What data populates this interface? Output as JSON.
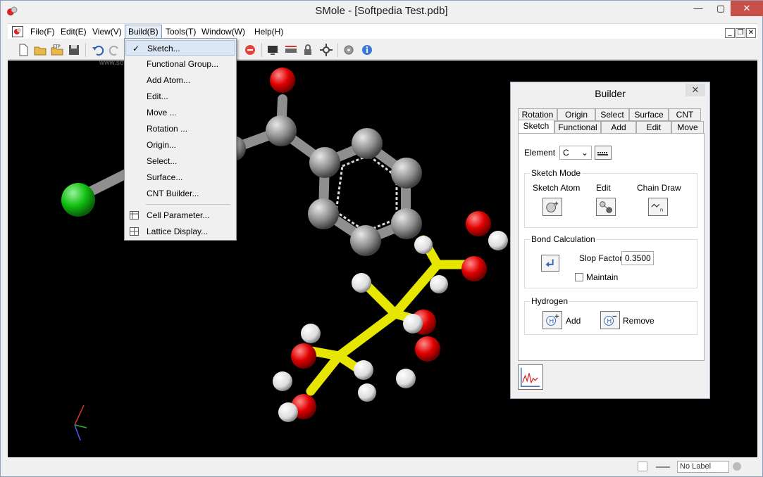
{
  "window": {
    "title": "SMole - [Softpedia Test.pdb]"
  },
  "menubar": {
    "items": [
      {
        "label": "File(F)"
      },
      {
        "label": "Edit(E)"
      },
      {
        "label": "View(V)"
      },
      {
        "label": "Build(B)"
      },
      {
        "label": "Tools(T)"
      },
      {
        "label": "Window(W)"
      },
      {
        "label": "Help(H)"
      }
    ]
  },
  "build_menu": {
    "items": [
      {
        "label": "Sketch...",
        "checked": true
      },
      {
        "label": "Functional Group..."
      },
      {
        "label": "Add Atom..."
      },
      {
        "label": "Edit..."
      },
      {
        "label": "Move ..."
      },
      {
        "label": "Rotation ..."
      },
      {
        "label": "Origin..."
      },
      {
        "label": "Select..."
      },
      {
        "label": "Surface..."
      },
      {
        "label": "CNT Builder..."
      },
      {
        "label": "Cell Parameter..."
      },
      {
        "label": "Lattice Display..."
      }
    ]
  },
  "viewport": {
    "watermark": "www.softpedia.com"
  },
  "builder": {
    "title": "Builder",
    "close": "✕",
    "tabs_row1": [
      "Rotation",
      "Origin",
      "Select",
      "Surface",
      "CNT"
    ],
    "tabs_row2": [
      "Sketch",
      "Functional",
      "Add",
      "Edit",
      "Move"
    ],
    "element_label": "Element",
    "element_value": "C",
    "sketch_mode": {
      "title": "Sketch Mode",
      "options": [
        "Sketch Atom",
        "Edit",
        "Chain Draw"
      ]
    },
    "bond": {
      "title": "Bond Calculation",
      "slop_label": "Slop Factor:",
      "slop_value": "0.3500",
      "maintain_label": "Maintain"
    },
    "hydrogen": {
      "title": "Hydrogen",
      "add_label": "Add",
      "remove_label": "Remove"
    }
  },
  "statusbar": {
    "label_value": "No Label"
  }
}
